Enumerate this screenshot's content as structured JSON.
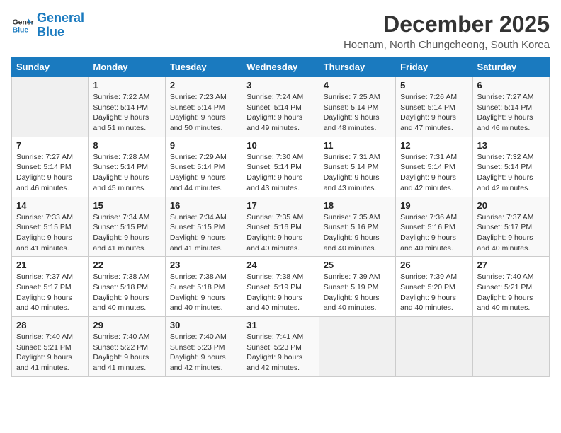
{
  "logo": {
    "line1": "General",
    "line2": "Blue"
  },
  "title": "December 2025",
  "location": "Hoenam, North Chungcheong, South Korea",
  "weekdays": [
    "Sunday",
    "Monday",
    "Tuesday",
    "Wednesday",
    "Thursday",
    "Friday",
    "Saturday"
  ],
  "weeks": [
    [
      {
        "day": "",
        "info": ""
      },
      {
        "day": "1",
        "info": "Sunrise: 7:22 AM\nSunset: 5:14 PM\nDaylight: 9 hours\nand 51 minutes."
      },
      {
        "day": "2",
        "info": "Sunrise: 7:23 AM\nSunset: 5:14 PM\nDaylight: 9 hours\nand 50 minutes."
      },
      {
        "day": "3",
        "info": "Sunrise: 7:24 AM\nSunset: 5:14 PM\nDaylight: 9 hours\nand 49 minutes."
      },
      {
        "day": "4",
        "info": "Sunrise: 7:25 AM\nSunset: 5:14 PM\nDaylight: 9 hours\nand 48 minutes."
      },
      {
        "day": "5",
        "info": "Sunrise: 7:26 AM\nSunset: 5:14 PM\nDaylight: 9 hours\nand 47 minutes."
      },
      {
        "day": "6",
        "info": "Sunrise: 7:27 AM\nSunset: 5:14 PM\nDaylight: 9 hours\nand 46 minutes."
      }
    ],
    [
      {
        "day": "7",
        "info": "Sunrise: 7:27 AM\nSunset: 5:14 PM\nDaylight: 9 hours\nand 46 minutes."
      },
      {
        "day": "8",
        "info": "Sunrise: 7:28 AM\nSunset: 5:14 PM\nDaylight: 9 hours\nand 45 minutes."
      },
      {
        "day": "9",
        "info": "Sunrise: 7:29 AM\nSunset: 5:14 PM\nDaylight: 9 hours\nand 44 minutes."
      },
      {
        "day": "10",
        "info": "Sunrise: 7:30 AM\nSunset: 5:14 PM\nDaylight: 9 hours\nand 43 minutes."
      },
      {
        "day": "11",
        "info": "Sunrise: 7:31 AM\nSunset: 5:14 PM\nDaylight: 9 hours\nand 43 minutes."
      },
      {
        "day": "12",
        "info": "Sunrise: 7:31 AM\nSunset: 5:14 PM\nDaylight: 9 hours\nand 42 minutes."
      },
      {
        "day": "13",
        "info": "Sunrise: 7:32 AM\nSunset: 5:14 PM\nDaylight: 9 hours\nand 42 minutes."
      }
    ],
    [
      {
        "day": "14",
        "info": "Sunrise: 7:33 AM\nSunset: 5:15 PM\nDaylight: 9 hours\nand 41 minutes."
      },
      {
        "day": "15",
        "info": "Sunrise: 7:34 AM\nSunset: 5:15 PM\nDaylight: 9 hours\nand 41 minutes."
      },
      {
        "day": "16",
        "info": "Sunrise: 7:34 AM\nSunset: 5:15 PM\nDaylight: 9 hours\nand 41 minutes."
      },
      {
        "day": "17",
        "info": "Sunrise: 7:35 AM\nSunset: 5:16 PM\nDaylight: 9 hours\nand 40 minutes."
      },
      {
        "day": "18",
        "info": "Sunrise: 7:35 AM\nSunset: 5:16 PM\nDaylight: 9 hours\nand 40 minutes."
      },
      {
        "day": "19",
        "info": "Sunrise: 7:36 AM\nSunset: 5:16 PM\nDaylight: 9 hours\nand 40 minutes."
      },
      {
        "day": "20",
        "info": "Sunrise: 7:37 AM\nSunset: 5:17 PM\nDaylight: 9 hours\nand 40 minutes."
      }
    ],
    [
      {
        "day": "21",
        "info": "Sunrise: 7:37 AM\nSunset: 5:17 PM\nDaylight: 9 hours\nand 40 minutes."
      },
      {
        "day": "22",
        "info": "Sunrise: 7:38 AM\nSunset: 5:18 PM\nDaylight: 9 hours\nand 40 minutes."
      },
      {
        "day": "23",
        "info": "Sunrise: 7:38 AM\nSunset: 5:18 PM\nDaylight: 9 hours\nand 40 minutes."
      },
      {
        "day": "24",
        "info": "Sunrise: 7:38 AM\nSunset: 5:19 PM\nDaylight: 9 hours\nand 40 minutes."
      },
      {
        "day": "25",
        "info": "Sunrise: 7:39 AM\nSunset: 5:19 PM\nDaylight: 9 hours\nand 40 minutes."
      },
      {
        "day": "26",
        "info": "Sunrise: 7:39 AM\nSunset: 5:20 PM\nDaylight: 9 hours\nand 40 minutes."
      },
      {
        "day": "27",
        "info": "Sunrise: 7:40 AM\nSunset: 5:21 PM\nDaylight: 9 hours\nand 40 minutes."
      }
    ],
    [
      {
        "day": "28",
        "info": "Sunrise: 7:40 AM\nSunset: 5:21 PM\nDaylight: 9 hours\nand 41 minutes."
      },
      {
        "day": "29",
        "info": "Sunrise: 7:40 AM\nSunset: 5:22 PM\nDaylight: 9 hours\nand 41 minutes."
      },
      {
        "day": "30",
        "info": "Sunrise: 7:40 AM\nSunset: 5:23 PM\nDaylight: 9 hours\nand 42 minutes."
      },
      {
        "day": "31",
        "info": "Sunrise: 7:41 AM\nSunset: 5:23 PM\nDaylight: 9 hours\nand 42 minutes."
      },
      {
        "day": "",
        "info": ""
      },
      {
        "day": "",
        "info": ""
      },
      {
        "day": "",
        "info": ""
      }
    ]
  ]
}
